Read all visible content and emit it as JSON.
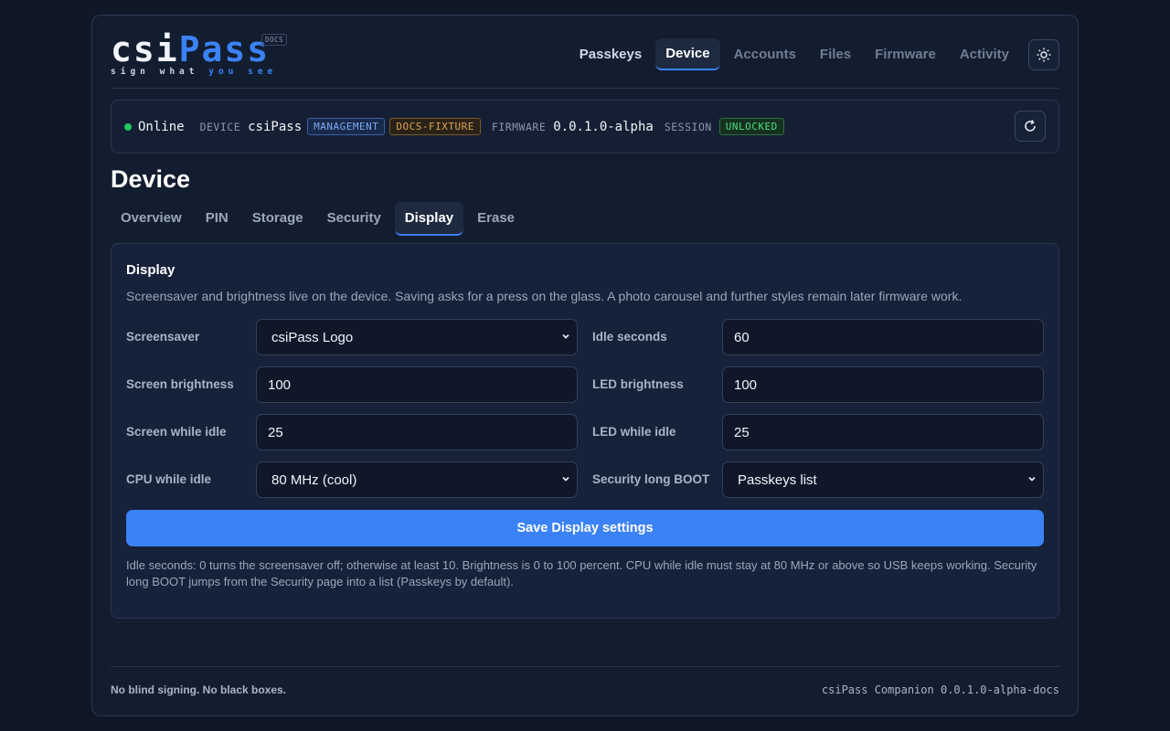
{
  "header": {
    "logo_csi": "csi",
    "logo_pass": "Pass",
    "docs_badge": "DOCS",
    "tagline_a": "sign what",
    "tagline_b": "you see",
    "nav": [
      "Passkeys",
      "Device",
      "Accounts",
      "Files",
      "Firmware",
      "Activity"
    ],
    "active_nav": "Device",
    "theme_icon": "sun-icon"
  },
  "status": {
    "state": "Online",
    "device_key": "DEVICE",
    "device_name": "csiPass",
    "badge_management": "MANAGEMENT",
    "badge_fixture": "DOCS-FIXTURE",
    "firmware_key": "FIRMWARE",
    "firmware_version": "0.0.1.0-alpha",
    "session_key": "SESSION",
    "session_state": "UNLOCKED",
    "refresh_icon": "refresh-icon",
    "online_color": "#22c55e"
  },
  "page": {
    "title": "Device",
    "tabs": [
      "Overview",
      "PIN",
      "Storage",
      "Security",
      "Display",
      "Erase"
    ],
    "active_tab": "Display"
  },
  "panel": {
    "title": "Display",
    "description": "Screensaver and brightness live on the device. Saving asks for a press on the glass. A photo carousel and further styles remain later firmware work.",
    "fields": {
      "screensaver": {
        "label": "Screensaver",
        "value": "csiPass Logo"
      },
      "idle_seconds": {
        "label": "Idle seconds",
        "value": "60"
      },
      "screen_brightness": {
        "label": "Screen brightness",
        "value": "100"
      },
      "led_brightness": {
        "label": "LED brightness",
        "value": "100"
      },
      "screen_idle": {
        "label": "Screen while idle",
        "value": "25"
      },
      "led_idle": {
        "label": "LED while idle",
        "value": "25"
      },
      "cpu_idle": {
        "label": "CPU while idle",
        "value": "80 MHz (cool)"
      },
      "security_boot": {
        "label": "Security long BOOT",
        "value": "Passkeys list"
      }
    },
    "save_label": "Save Display settings",
    "help_text": "Idle seconds: 0 turns the screensaver off; otherwise at least 10. Brightness is 0 to 100 percent. CPU while idle must stay at 80 MHz or above so USB keeps working. Security long BOOT jumps from the Security page into a list (Passkeys by default)."
  },
  "footer": {
    "left": "No blind signing. No black boxes.",
    "right": "csiPass Companion 0.0.1.0-alpha-docs"
  },
  "colors": {
    "accent": "#3b82f6",
    "background": "#101828",
    "surface": "#131d30"
  }
}
